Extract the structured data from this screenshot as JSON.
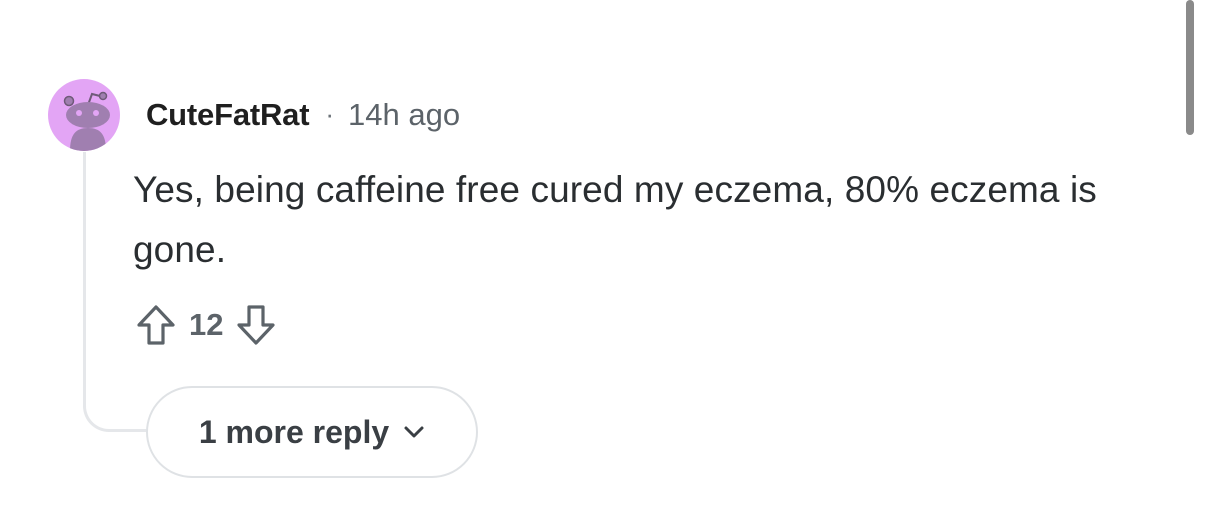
{
  "comment": {
    "username": "CuteFatRat",
    "separator": "·",
    "timestamp": "14h ago",
    "body": "Yes, being caffeine free cured my eczema, 80% eczema is gone.",
    "score": "12",
    "more_replies_label": "1 more reply"
  },
  "icons": {
    "avatar": "snoo-avatar-icon",
    "upvote": "arrow-up-outline-icon",
    "downvote": "arrow-down-outline-icon",
    "expand": "chevron-down-icon"
  },
  "colors": {
    "avatar_background": "#e3a5f5",
    "avatar_figure": "#a07fb0",
    "thread_line": "#e5e7ea",
    "secondary_text": "#5c6369"
  }
}
